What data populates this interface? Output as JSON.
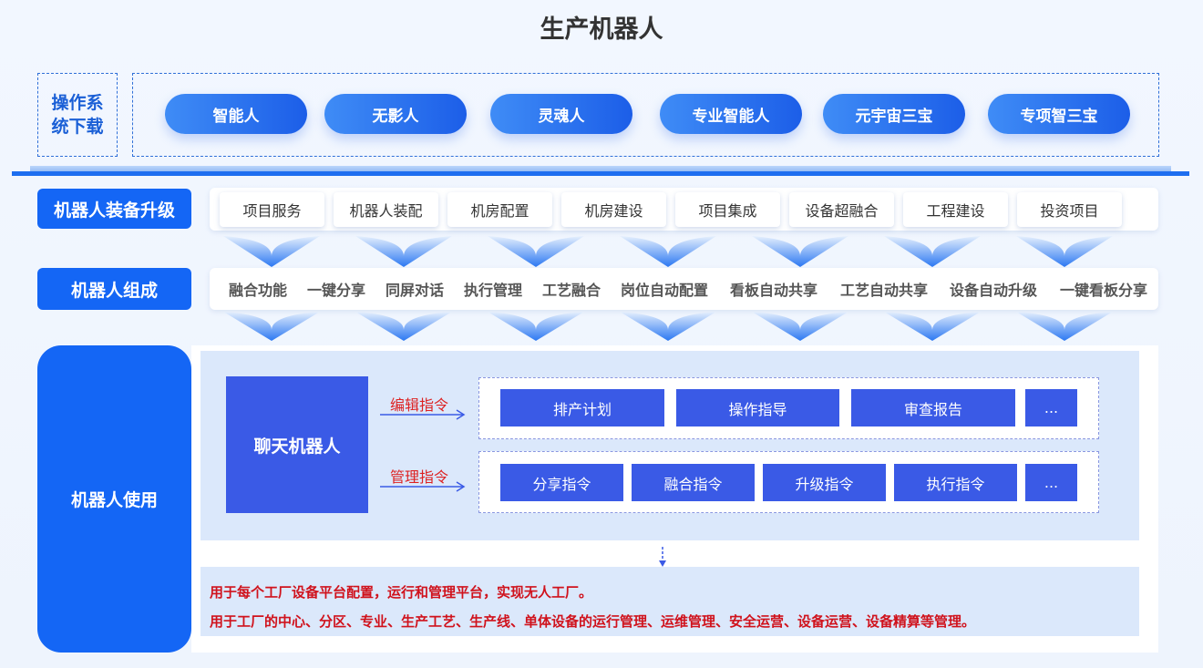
{
  "title": "生产机器人",
  "download_label": "操作系统下载",
  "top_pills": [
    "智能人",
    "无影人",
    "灵魂人",
    "专业智能人",
    "元宇宙三宝",
    "专项智三宝"
  ],
  "equip": {
    "label": "机器人装备升级",
    "items": [
      "项目服务",
      "机器人装配",
      "机房配置",
      "机房建设",
      "项目集成",
      "设备超融合",
      "工程建设",
      "投资项目"
    ]
  },
  "composition": {
    "label": "机器人组成",
    "items": [
      "融合功能",
      "一键分享",
      "同屏对话",
      "执行管理",
      "工艺融合",
      "岗位自动配置",
      "看板自动共享",
      "工艺自动共享",
      "设备自动升级",
      "一键看板分享"
    ]
  },
  "usage": {
    "label": "机器人使用",
    "chat_bot": "聊天机器人",
    "edit_cmd_label": "编辑指令",
    "manage_cmd_label": "管理指令",
    "edit_cmds": [
      "排产计划",
      "操作指导",
      "审查报告",
      "..."
    ],
    "manage_cmds": [
      "分享指令",
      "融合指令",
      "升级指令",
      "执行指令",
      "..."
    ],
    "desc": [
      "用于每个工厂设备平台配置，运行和管理平台，实现无人工厂。",
      "用于工厂的中心、分区、专业、生产工艺、生产线、单体设备的运行管理、运维管理、安全运营、设备运营、设备精算等管理。"
    ]
  },
  "colors": {
    "primary": "#1466f5",
    "cmd_blue": "#3a5ae6",
    "accent_red": "#d0121c"
  }
}
